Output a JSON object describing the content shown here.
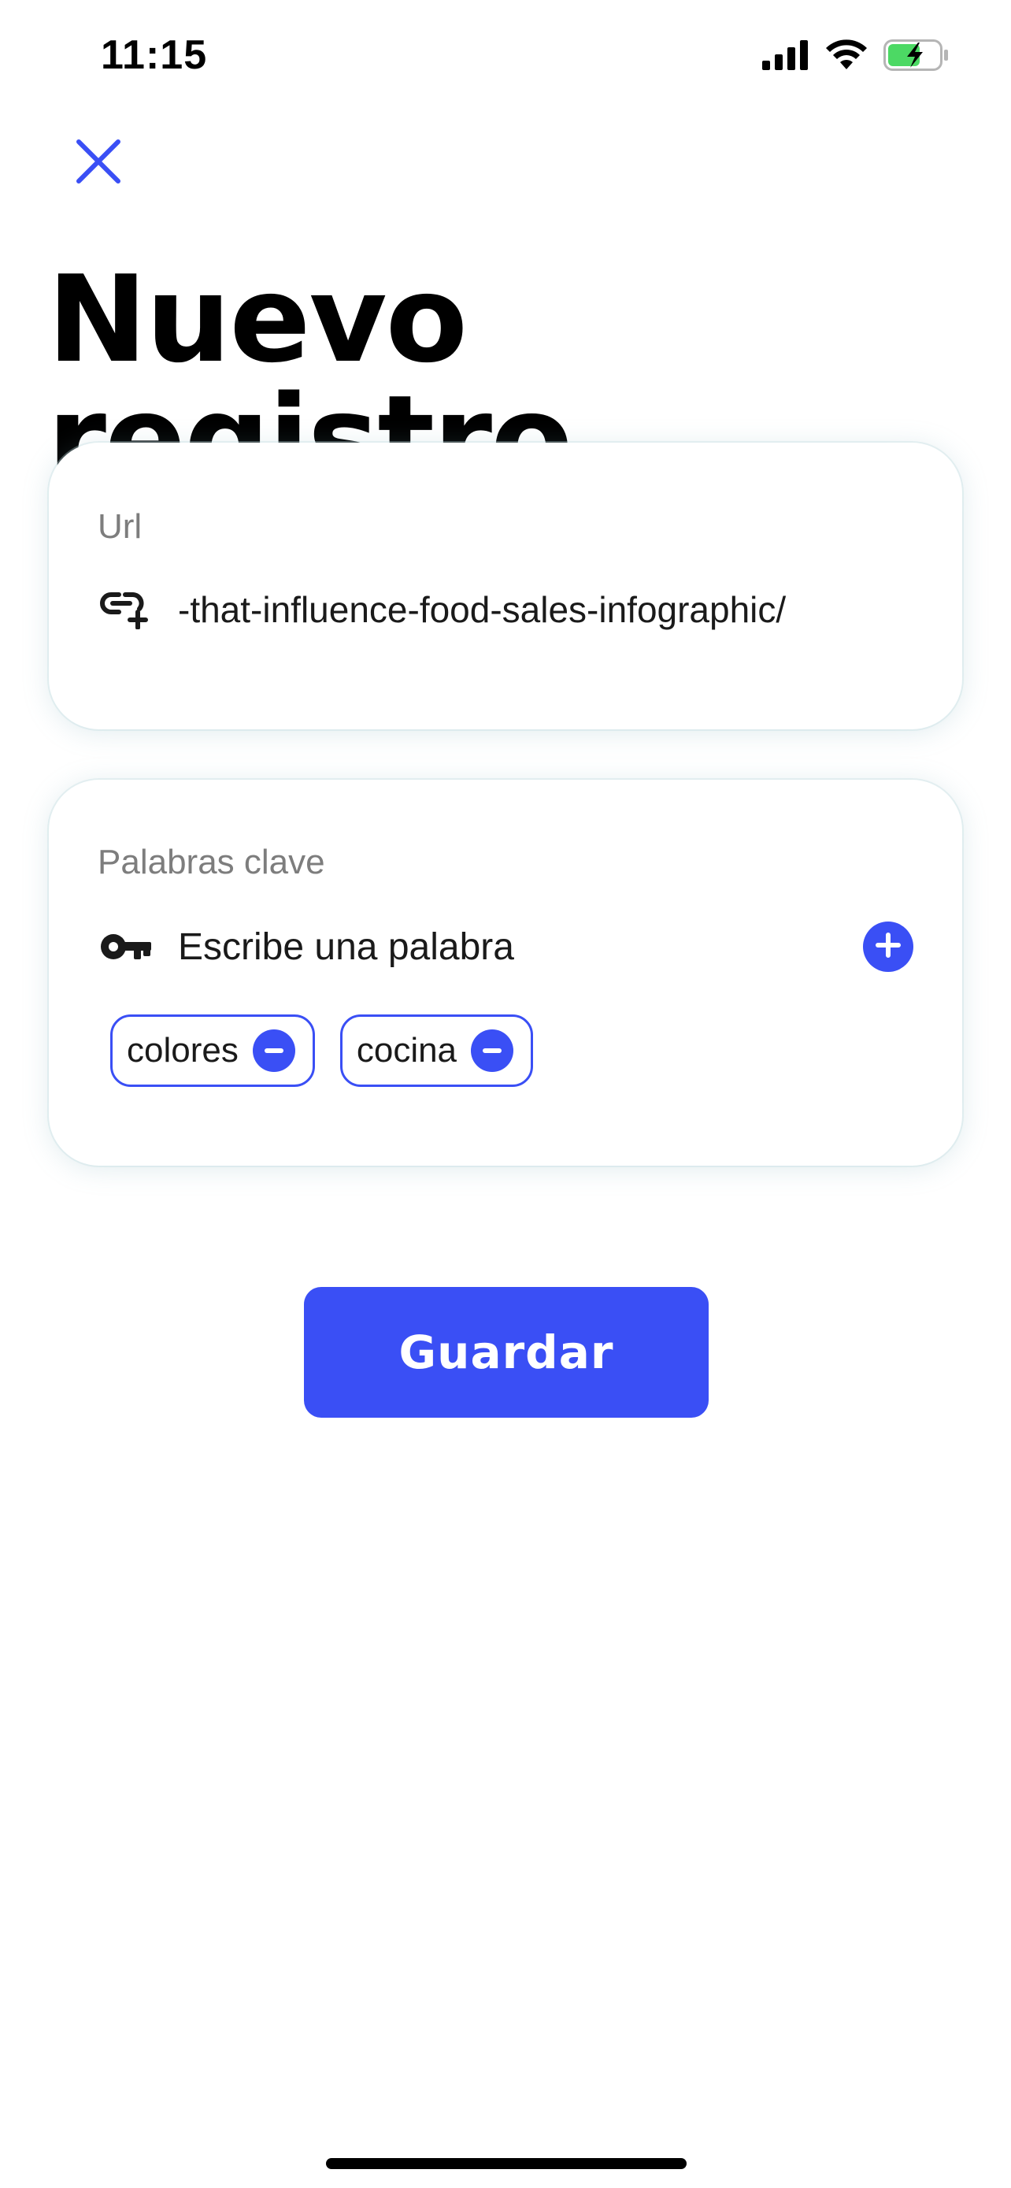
{
  "status_bar": {
    "time": "11:15",
    "icons": [
      "cellular-signal-icon",
      "wifi-icon",
      "battery-charging-icon"
    ]
  },
  "header": {
    "close_icon": "close-icon",
    "title": "Nuevo registro"
  },
  "url_field": {
    "label": "Url",
    "icon": "link-add-icon",
    "value": "-that-influence-food-sales-infographic/"
  },
  "keywords_field": {
    "label": "Palabras clave",
    "icon": "key-icon",
    "placeholder": "Escribe una palabra",
    "add_icon": "plus-circle-icon",
    "chips": [
      {
        "label": "colores"
      },
      {
        "label": "cocina"
      }
    ]
  },
  "actions": {
    "save_label": "Guardar"
  },
  "colors": {
    "accent": "#3a4ff5",
    "label": "#7d7d7d",
    "battery": "#4cd964"
  }
}
